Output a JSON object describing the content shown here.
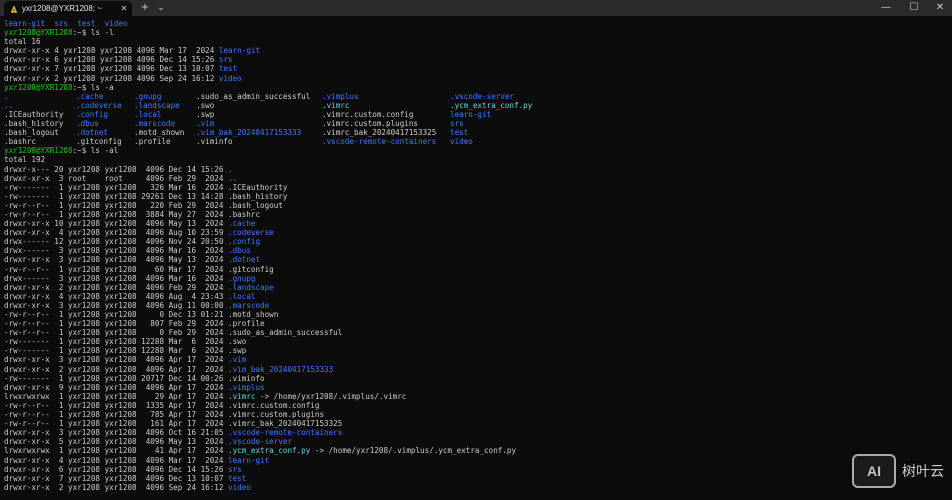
{
  "window": {
    "tab_title": "yxr1208@YXR1208: ~",
    "tab_close": "✕",
    "new_tab": "+",
    "dropdown": "⌄",
    "minimize": "—",
    "maximize": "☐",
    "close": "✕"
  },
  "colors": {
    "prompt": "#16c60c",
    "directory": "#3b78ff",
    "symlink": "#61d6d6",
    "text": "#cccccc",
    "background": "#0c0c0c"
  },
  "terminal": {
    "lines": [
      {
        "type": "cols",
        "cells": [
          {
            "t": "learn-git",
            "c": "blu"
          },
          {
            "t": "  "
          },
          {
            "t": "srs",
            "c": "blu"
          },
          {
            "t": "  "
          },
          {
            "t": "test",
            "c": "blu"
          },
          {
            "t": "  "
          },
          {
            "t": "video",
            "c": "blu"
          }
        ]
      },
      {
        "type": "cols",
        "cells": [
          {
            "t": "yxr1208@YXR1208",
            "c": "grn"
          },
          {
            "t": ":~$ ls -l"
          }
        ]
      },
      {
        "type": "cols",
        "cells": [
          {
            "t": "total 16"
          }
        ]
      },
      {
        "type": "cols",
        "cells": [
          {
            "t": "drwxr-xr-x 4 yxr1208 yxr1208 4096 Mar 17  2024 "
          },
          {
            "t": "learn-git",
            "c": "blu"
          }
        ]
      },
      {
        "type": "cols",
        "cells": [
          {
            "t": "drwxr-xr-x 6 yxr1208 yxr1208 4096 Dec 14 15:26 "
          },
          {
            "t": "srs",
            "c": "blu"
          }
        ]
      },
      {
        "type": "cols",
        "cells": [
          {
            "t": "drwxr-xr-x 7 yxr1208 yxr1208 4096 Dec 13 10:07 "
          },
          {
            "t": "test",
            "c": "blu"
          }
        ]
      },
      {
        "type": "cols",
        "cells": [
          {
            "t": "drwxr-xr-x 2 yxr1208 yxr1208 4096 Sep 24 16:12 "
          },
          {
            "t": "video",
            "c": "blu"
          }
        ]
      },
      {
        "type": "cols",
        "cells": [
          {
            "t": "yxr1208@YXR1208",
            "c": "grn"
          },
          {
            "t": ":~$ ls -a"
          }
        ]
      },
      {
        "type": "grid",
        "cells": [
          {
            "t": ".",
            "c": "blu"
          },
          {
            "t": ".cache",
            "c": "blu"
          },
          {
            "t": ".gnupg",
            "c": "blu"
          },
          {
            "t": ".sudo_as_admin_successful"
          },
          {
            "t": ".vimplus",
            "c": "blu"
          },
          {
            "t": ".vscode-server",
            "c": "blu"
          }
        ]
      },
      {
        "type": "grid",
        "cells": [
          {
            "t": "..",
            "c": "blu"
          },
          {
            "t": ".codeverse",
            "c": "blu"
          },
          {
            "t": ".landscape",
            "c": "blu"
          },
          {
            "t": ".swo"
          },
          {
            "t": ".vimrc",
            "c": "cyn"
          },
          {
            "t": ".ycm_extra_conf.py",
            "c": "cyn"
          }
        ]
      },
      {
        "type": "grid",
        "cells": [
          {
            "t": ".ICEauthority"
          },
          {
            "t": ".config",
            "c": "blu"
          },
          {
            "t": ".local",
            "c": "blu"
          },
          {
            "t": ".swp"
          },
          {
            "t": ".vimrc.custom.config"
          },
          {
            "t": "learn-git",
            "c": "blu"
          }
        ]
      },
      {
        "type": "grid",
        "cells": [
          {
            "t": ".bash_history"
          },
          {
            "t": ".dbus",
            "c": "blu"
          },
          {
            "t": ".marscode",
            "c": "blu"
          },
          {
            "t": ".vim",
            "c": "blu"
          },
          {
            "t": ".vimrc.custom.plugins"
          },
          {
            "t": "srs",
            "c": "blu"
          }
        ]
      },
      {
        "type": "grid",
        "cells": [
          {
            "t": ".bash_logout"
          },
          {
            "t": ".dotnet",
            "c": "blu"
          },
          {
            "t": ".motd_shown"
          },
          {
            "t": ".vim_bak_20240417153333",
            "c": "blu"
          },
          {
            "t": ".vimrc_bak_20240417153325"
          },
          {
            "t": "test",
            "c": "blu"
          }
        ]
      },
      {
        "type": "grid",
        "cells": [
          {
            "t": ".bashrc"
          },
          {
            "t": ".gitconfig"
          },
          {
            "t": ".profile"
          },
          {
            "t": ".viminfo"
          },
          {
            "t": ".vscode-remote-containers",
            "c": "blu"
          },
          {
            "t": "video",
            "c": "blu"
          }
        ]
      },
      {
        "type": "cols",
        "cells": [
          {
            "t": "yxr1208@YXR1208",
            "c": "grn"
          },
          {
            "t": ":~$ ls -al"
          }
        ]
      },
      {
        "type": "cols",
        "cells": [
          {
            "t": "total 192"
          }
        ]
      },
      {
        "type": "cols",
        "cells": [
          {
            "t": "drwxr-x--- 20 yxr1208 yxr1208  4096 Dec 14 15:26 "
          },
          {
            "t": ".",
            "c": "blu"
          }
        ]
      },
      {
        "type": "cols",
        "cells": [
          {
            "t": "drwxr-xr-x  3 root    root     4096 Feb 29  2024 "
          },
          {
            "t": "..",
            "c": "blu"
          }
        ]
      },
      {
        "type": "cols",
        "cells": [
          {
            "t": "-rw-------  1 yxr1208 yxr1208   326 Mar 16  2024 .ICEauthority"
          }
        ]
      },
      {
        "type": "cols",
        "cells": [
          {
            "t": "-rw-------  1 yxr1208 yxr1208 29261 Dec 13 14:28 .bash_history"
          }
        ]
      },
      {
        "type": "cols",
        "cells": [
          {
            "t": "-rw-r--r--  1 yxr1208 yxr1208   220 Feb 29  2024 .bash_logout"
          }
        ]
      },
      {
        "type": "cols",
        "cells": [
          {
            "t": "-rw-r--r--  1 yxr1208 yxr1208  3884 May 27  2024 .bashrc"
          }
        ]
      },
      {
        "type": "cols",
        "cells": [
          {
            "t": "drwxr-xr-x 10 yxr1208 yxr1208  4096 May 13  2024 "
          },
          {
            "t": ".cache",
            "c": "blu"
          }
        ]
      },
      {
        "type": "cols",
        "cells": [
          {
            "t": "drwxr-xr-x  4 yxr1208 yxr1208  4096 Aug 10 23:59 "
          },
          {
            "t": ".codeverse",
            "c": "blu"
          }
        ]
      },
      {
        "type": "cols",
        "cells": [
          {
            "t": "drwx------ 12 yxr1208 yxr1208  4096 Nov 24 20:50 "
          },
          {
            "t": ".config",
            "c": "blu"
          }
        ]
      },
      {
        "type": "cols",
        "cells": [
          {
            "t": "drwx------  3 yxr1208 yxr1208  4096 Mar 16  2024 "
          },
          {
            "t": ".dbus",
            "c": "blu"
          }
        ]
      },
      {
        "type": "cols",
        "cells": [
          {
            "t": "drwxr-xr-x  3 yxr1208 yxr1208  4096 May 13  2024 "
          },
          {
            "t": ".dotnet",
            "c": "blu"
          }
        ]
      },
      {
        "type": "cols",
        "cells": [
          {
            "t": "-rw-r--r--  1 yxr1208 yxr1208    60 Mar 17  2024 .gitconfig"
          }
        ]
      },
      {
        "type": "cols",
        "cells": [
          {
            "t": "drwx------  3 yxr1208 yxr1208  4096 Mar 16  2024 "
          },
          {
            "t": ".gnupg",
            "c": "blu"
          }
        ]
      },
      {
        "type": "cols",
        "cells": [
          {
            "t": "drwxr-xr-x  2 yxr1208 yxr1208  4096 Feb 29  2024 "
          },
          {
            "t": ".landscape",
            "c": "blu"
          }
        ]
      },
      {
        "type": "cols",
        "cells": [
          {
            "t": "drwxr-xr-x  4 yxr1208 yxr1208  4096 Aug  4 23:43 "
          },
          {
            "t": ".local",
            "c": "blu"
          }
        ]
      },
      {
        "type": "cols",
        "cells": [
          {
            "t": "drwxr-xr-x  3 yxr1208 yxr1208  4096 Aug 11 00:00 "
          },
          {
            "t": ".marscode",
            "c": "blu"
          }
        ]
      },
      {
        "type": "cols",
        "cells": [
          {
            "t": "-rw-r--r--  1 yxr1208 yxr1208     0 Dec 13 01:21 .motd_shown"
          }
        ]
      },
      {
        "type": "cols",
        "cells": [
          {
            "t": "-rw-r--r--  1 yxr1208 yxr1208   807 Feb 29  2024 .profile"
          }
        ]
      },
      {
        "type": "cols",
        "cells": [
          {
            "t": "-rw-r--r--  1 yxr1208 yxr1208     0 Feb 29  2024 .sudo_as_admin_successful"
          }
        ]
      },
      {
        "type": "cols",
        "cells": [
          {
            "t": "-rw-------  1 yxr1208 yxr1208 12288 Mar  6  2024 .swo"
          }
        ]
      },
      {
        "type": "cols",
        "cells": [
          {
            "t": "-rw-------  1 yxr1208 yxr1208 12288 Mar  6  2024 .swp"
          }
        ]
      },
      {
        "type": "cols",
        "cells": [
          {
            "t": "drwxr-xr-x  3 yxr1208 yxr1208  4096 Apr 17  2024 "
          },
          {
            "t": ".vim",
            "c": "blu"
          }
        ]
      },
      {
        "type": "cols",
        "cells": [
          {
            "t": "drwxr-xr-x  2 yxr1208 yxr1208  4096 Apr 17  2024 "
          },
          {
            "t": ".vim_bak_20240417153333",
            "c": "blu"
          }
        ]
      },
      {
        "type": "cols",
        "cells": [
          {
            "t": "-rw-------  1 yxr1208 yxr1208 20717 Dec 14 00:26 .viminfo"
          }
        ]
      },
      {
        "type": "cols",
        "cells": [
          {
            "t": "drwxr-xr-x  9 yxr1208 yxr1208  4096 Apr 17  2024 "
          },
          {
            "t": ".vimplus",
            "c": "blu"
          }
        ]
      },
      {
        "type": "cols",
        "cells": [
          {
            "t": "lrwxrwxrwx  1 yxr1208 yxr1208    29 Apr 17  2024 "
          },
          {
            "t": ".vimrc",
            "c": "cyn"
          },
          {
            "t": " -> /home/yxr1208/.vimplus/.vimrc"
          }
        ]
      },
      {
        "type": "cols",
        "cells": [
          {
            "t": "-rw-r--r--  1 yxr1208 yxr1208  1335 Apr 17  2024 .vimrc.custom.config"
          }
        ]
      },
      {
        "type": "cols",
        "cells": [
          {
            "t": "-rw-r--r--  1 yxr1208 yxr1208   785 Apr 17  2024 .vimrc.custom.plugins"
          }
        ]
      },
      {
        "type": "cols",
        "cells": [
          {
            "t": "-rw-r--r--  1 yxr1208 yxr1208   161 Apr 17  2024 .vimrc_bak_20240417153325"
          }
        ]
      },
      {
        "type": "cols",
        "cells": [
          {
            "t": "drwxr-xr-x  3 yxr1208 yxr1208  4096 Oct 16 21:05 "
          },
          {
            "t": ".vscode-remote-containers",
            "c": "blu"
          }
        ]
      },
      {
        "type": "cols",
        "cells": [
          {
            "t": "drwxr-xr-x  5 yxr1208 yxr1208  4096 May 13  2024 "
          },
          {
            "t": ".vscode-server",
            "c": "blu"
          }
        ]
      },
      {
        "type": "cols",
        "cells": [
          {
            "t": "lrwxrwxrwx  1 yxr1208 yxr1208    41 Apr 17  2024 "
          },
          {
            "t": ".ycm_extra_conf.py",
            "c": "cyn"
          },
          {
            "t": " -> /home/yxr1208/.vimplus/.ycm_extra_conf.py"
          }
        ]
      },
      {
        "type": "cols",
        "cells": [
          {
            "t": "drwxr-xr-x  4 yxr1208 yxr1208  4096 Mar 17  2024 "
          },
          {
            "t": "learn-git",
            "c": "blu"
          }
        ]
      },
      {
        "type": "cols",
        "cells": [
          {
            "t": "drwxr-xr-x  6 yxr1208 yxr1208  4096 Dec 14 15:26 "
          },
          {
            "t": "srs",
            "c": "blu"
          }
        ]
      },
      {
        "type": "cols",
        "cells": [
          {
            "t": "drwxr-xr-x  7 yxr1208 yxr1208  4096 Dec 13 10:07 "
          },
          {
            "t": "test",
            "c": "blu"
          }
        ]
      },
      {
        "type": "cols",
        "cells": [
          {
            "t": "drwxr-xr-x  2 yxr1208 yxr1208  4096 Sep 24 16:12 "
          },
          {
            "t": "video",
            "c": "blu"
          }
        ]
      }
    ]
  },
  "watermark": {
    "logo_text": "AI",
    "text": "树叶云"
  }
}
